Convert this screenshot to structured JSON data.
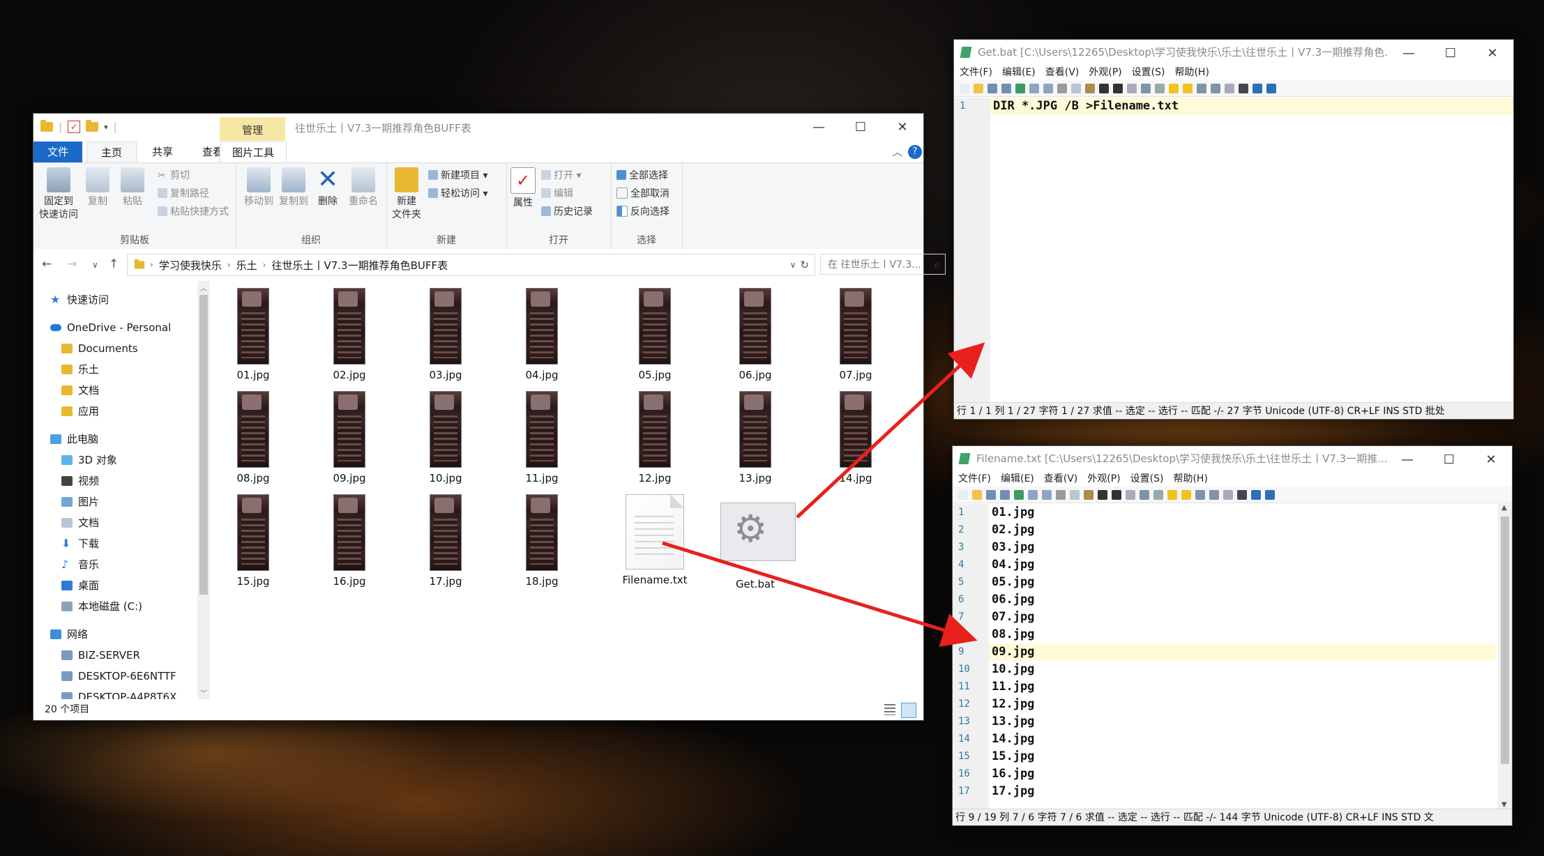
{
  "explorer": {
    "manage_tab": "管理",
    "title": "往世乐土丨V7.3一期推荐角色BUFF表",
    "tabs": [
      "文件",
      "主页",
      "共享",
      "查看",
      "图片工具"
    ],
    "window_controls": {
      "minimize": "—",
      "maximize": "☐",
      "close": "✕"
    },
    "ribbon": {
      "clipboard": {
        "group": "剪贴板",
        "pin": "固定到\n快速访问",
        "pin1": "固定到",
        "pin2": "快速访问",
        "copy": "复制",
        "paste": "粘贴",
        "cut": "剪切",
        "copy_path": "复制路径",
        "paste_shortcut": "粘贴快捷方式"
      },
      "organize": {
        "group": "组织",
        "move_to": "移动到",
        "copy_to": "复制到",
        "delete": "删除",
        "rename": "重命名"
      },
      "new": {
        "group": "新建",
        "new_folder1": "新建",
        "new_folder2": "文件夹",
        "new_item": "新建项目 ▾",
        "easy_access": "轻松访问 ▾"
      },
      "open": {
        "group": "打开",
        "properties": "属性",
        "open": "打开 ▾",
        "edit": "编辑",
        "history": "历史记录"
      },
      "select": {
        "group": "选择",
        "select_all": "全部选择",
        "select_none": "全部取消",
        "invert": "反向选择"
      }
    },
    "breadcrumbs": [
      "学习使我快乐",
      "乐土",
      "往世乐土丨V7.3一期推荐角色BUFF表"
    ],
    "search_placeholder": "在 往世乐土丨V7.3...",
    "nav": {
      "quick_access": "快速访问",
      "onedrive": "OneDrive - Personal",
      "od_items": [
        "Documents",
        "乐土",
        "文档",
        "应用"
      ],
      "this_pc": "此电脑",
      "pc_items": [
        "3D 对象",
        "视频",
        "图片",
        "文档",
        "下载",
        "音乐",
        "桌面",
        "本地磁盘 (C:)"
      ],
      "network": "网络",
      "net_items": [
        "BIZ-SERVER",
        "DESKTOP-6E6NTTF",
        "DESKTOP-A4P8T6X"
      ]
    },
    "files": [
      "01.jpg",
      "02.jpg",
      "03.jpg",
      "04.jpg",
      "05.jpg",
      "06.jpg",
      "07.jpg",
      "08.jpg",
      "09.jpg",
      "10.jpg",
      "11.jpg",
      "12.jpg",
      "13.jpg",
      "14.jpg",
      "15.jpg",
      "16.jpg",
      "17.jpg",
      "18.jpg",
      "Filename.txt",
      "Get.bat"
    ],
    "status": "20 个项目"
  },
  "getbat": {
    "title": "Get.bat [C:\\Users\\12265\\Desktop\\学习使我快乐\\乐土\\往世乐土丨V7.3一期推荐角色...",
    "menu": [
      "文件(F)",
      "编辑(E)",
      "查看(V)",
      "外观(P)",
      "设置(S)",
      "帮助(H)"
    ],
    "lines": [
      "DIR *.JPG /B >Filename.txt"
    ],
    "line_numbers": [
      "1"
    ],
    "status": "行 1 / 1   列 1 / 27   字符 1 / 27   求值 --   选定 --   选行 --   匹配 -/-   27 字节   Unicode (UTF-8)   CR+LF   INS   STD   批处"
  },
  "filename": {
    "title": "Filename.txt [C:\\Users\\12265\\Desktop\\学习使我快乐\\乐土\\往世乐土丨V7.3一期推...",
    "menu": [
      "文件(F)",
      "编辑(E)",
      "查看(V)",
      "外观(P)",
      "设置(S)",
      "帮助(H)"
    ],
    "line_numbers": [
      "1",
      "2",
      "3",
      "4",
      "5",
      "6",
      "7",
      "8",
      "9",
      "10",
      "11",
      "12",
      "13",
      "14",
      "15",
      "16",
      "17"
    ],
    "lines": [
      "01.jpg",
      "02.jpg",
      "03.jpg",
      "04.jpg",
      "05.jpg",
      "06.jpg",
      "07.jpg",
      "08.jpg",
      "09.jpg",
      "10.jpg",
      "11.jpg",
      "12.jpg",
      "13.jpg",
      "14.jpg",
      "15.jpg",
      "16.jpg",
      "17.jpg"
    ],
    "highlight_line": 9,
    "status": "行 9 / 19   列 7 / 6   字符 7 / 6   求值 --   选定 --   选行 --   匹配 -/-   144 字节   Unicode (UTF-8)   CR+LF   INS   STD   文"
  },
  "colors": {
    "accent": "#1b6ac9",
    "arrow": "#e8211d",
    "manage": "#f7e7a5",
    "line_highlight": "#fffbd8"
  }
}
